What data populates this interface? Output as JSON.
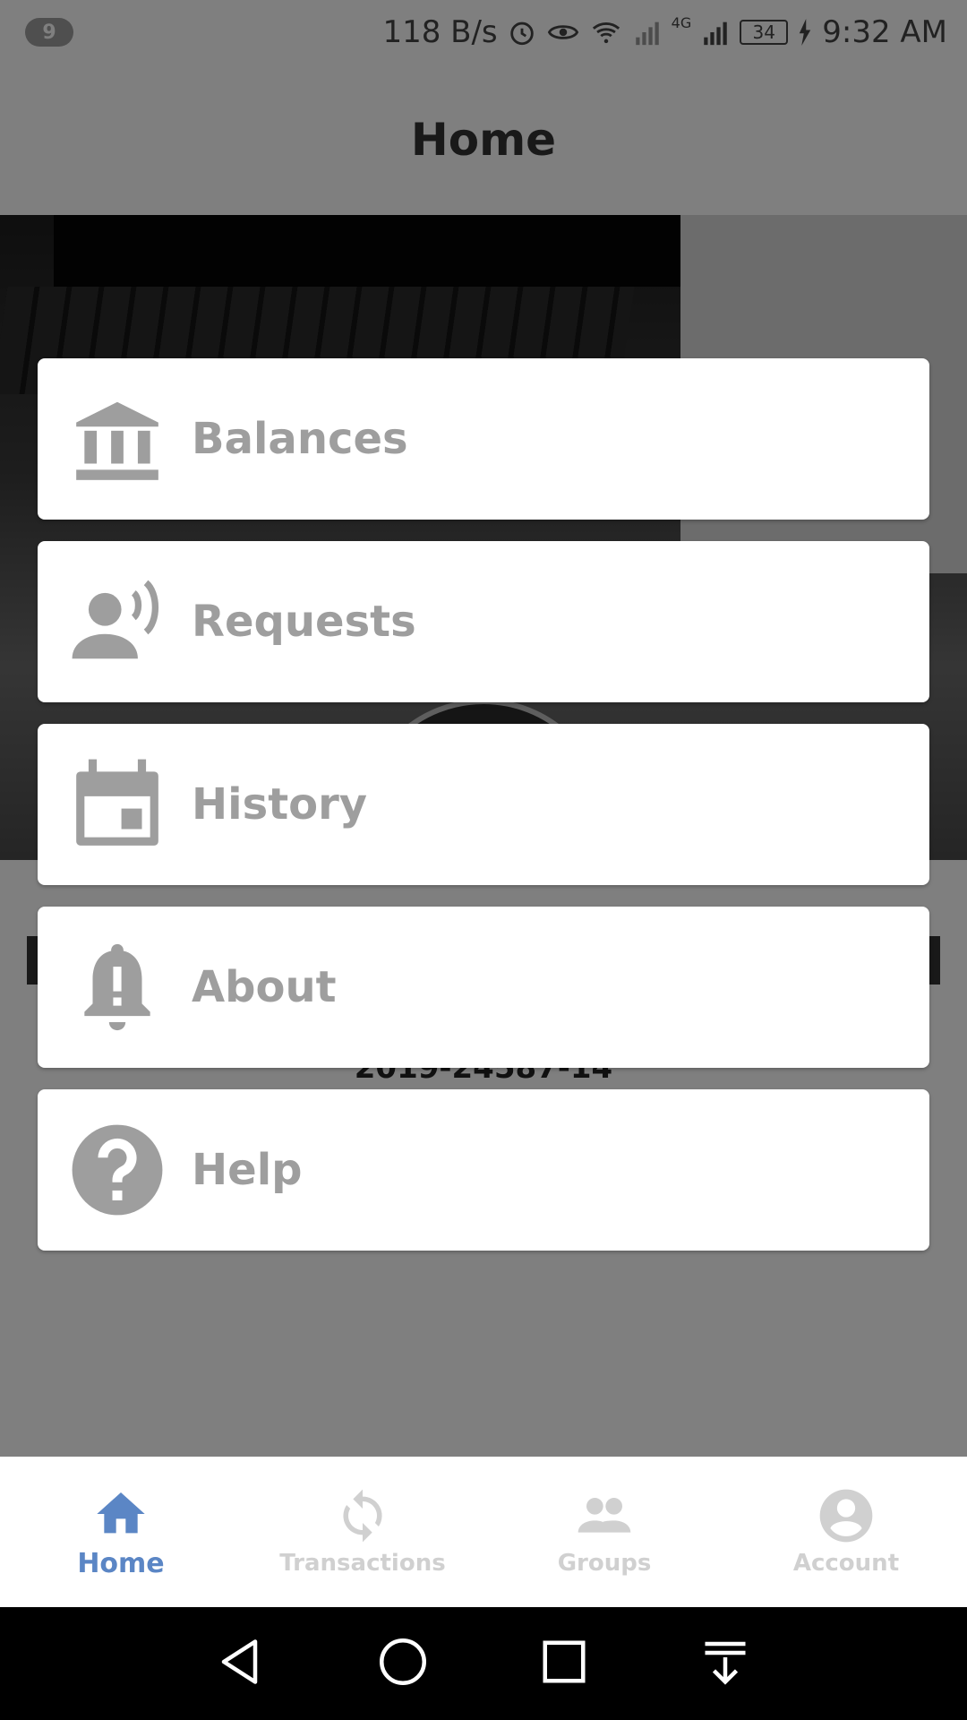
{
  "status_bar": {
    "notification_count": "9",
    "net_speed": "118 B/s",
    "network_type": "4G",
    "battery": "34",
    "time": "9:32 AM",
    "icons": [
      "alarm-icon",
      "eye-icon",
      "wifi-icon",
      "signal-icon",
      "charging-icon"
    ]
  },
  "app_bar": {
    "title": "Home"
  },
  "profile": {
    "id_number": "2019-24587-14"
  },
  "menu": {
    "items": [
      {
        "label": "Balances",
        "icon": "bank-icon"
      },
      {
        "label": "Requests",
        "icon": "voice-person-icon"
      },
      {
        "label": "History",
        "icon": "calendar-icon"
      },
      {
        "label": "About",
        "icon": "bell-alert-icon"
      },
      {
        "label": "Help",
        "icon": "help-circle-icon"
      }
    ]
  },
  "bottom_nav": {
    "items": [
      {
        "label": "Home",
        "icon": "home-icon",
        "active": true
      },
      {
        "label": "Transactions",
        "icon": "refresh-icon",
        "active": false
      },
      {
        "label": "Groups",
        "icon": "people-icon",
        "active": false
      },
      {
        "label": "Account",
        "icon": "account-circle-icon",
        "active": false
      }
    ]
  },
  "colors": {
    "accent": "#5b86c5",
    "menu_text": "#9e9e9e",
    "inactive_nav": "#d0d0d0"
  }
}
